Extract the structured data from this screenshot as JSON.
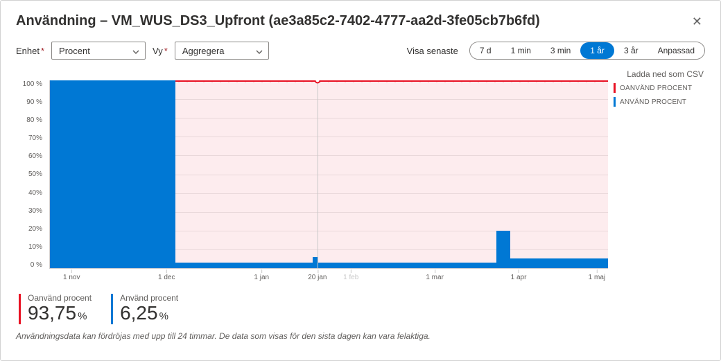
{
  "header": {
    "title": "Användning – VM_WUS_DS3_Upfront (ae3a85c2-7402-4777-aa2d-3fe05cb7b6fd)"
  },
  "controls": {
    "unit_label": "Enhet",
    "unit_value": "Procent",
    "view_label": "Vy",
    "view_value": "Aggregera",
    "range_label": "Visa senaste",
    "ranges": [
      {
        "label": "7 d",
        "active": false
      },
      {
        "label": "1 min",
        "active": false
      },
      {
        "label": "3 min",
        "active": false
      },
      {
        "label": "1 år",
        "active": true
      },
      {
        "label": "3 år",
        "active": false
      },
      {
        "label": "Anpassad",
        "active": false
      }
    ]
  },
  "csv_link": "Ladda ned som CSV",
  "legend": {
    "unused": "OANVÄND PROCENT",
    "used": "ANVÄND PROCENT"
  },
  "colors": {
    "unused": "#e81123",
    "used": "#0078d4"
  },
  "stats": {
    "unused_label": "Oanvänd procent",
    "unused_value": "93,75",
    "used_label": "Använd procent",
    "used_value": "6,25",
    "pct": "%"
  },
  "footer": "Användningsdata kan fördröjas med upp till 24 timmar. De data som visas för den sista dagen kan vara felaktiga.",
  "chart_data": {
    "type": "area",
    "title": "Användning – VM_WUS_DS3_Upfront",
    "ylabel": "%",
    "ylim": [
      0,
      100
    ],
    "y_ticks": [
      "100 %",
      "90 %",
      "80 %",
      "70%",
      "60%",
      "50%",
      "40%",
      "30%",
      "20%",
      "10%",
      "0 %"
    ],
    "x_ticks": [
      {
        "label": "1 nov",
        "pos": 4
      },
      {
        "label": "1 dec",
        "pos": 21
      },
      {
        "label": "1 jan",
        "pos": 38
      },
      {
        "label": "20 jan",
        "pos": 48,
        "marker": true
      },
      {
        "label": "1 feb",
        "pos": 54,
        "muted": true
      },
      {
        "label": "1 mar",
        "pos": 69
      },
      {
        "label": "1 apr",
        "pos": 84
      },
      {
        "label": "1 maj",
        "pos": 98
      }
    ],
    "series": [
      {
        "name": "Oanvänd procent",
        "color": "#e81123",
        "constant_value": 100
      },
      {
        "name": "Använd procent",
        "color": "#0078d4",
        "segments": [
          {
            "x_from": 0,
            "x_to": 22.5,
            "value": 100
          },
          {
            "x_from": 22.5,
            "x_to": 80,
            "value": 3
          },
          {
            "x_from": 80,
            "x_to": 82.5,
            "value": 20
          },
          {
            "x_from": 82.5,
            "x_to": 100,
            "value": 5
          }
        ],
        "bumps": [
          47.5
        ]
      }
    ]
  }
}
